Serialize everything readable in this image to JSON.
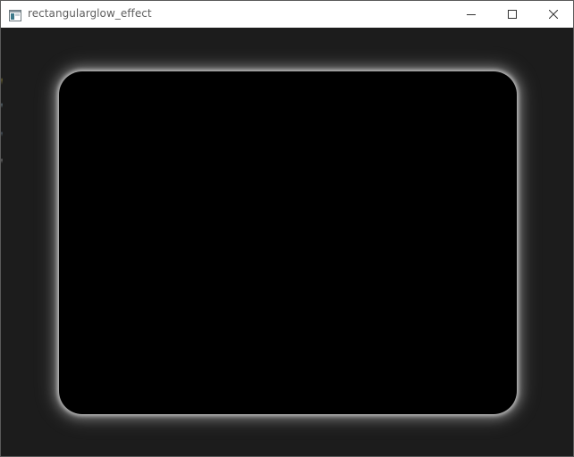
{
  "window": {
    "title": "rectangularglow_effect",
    "app_icon": "app-window-icon",
    "controls": {
      "minimize_icon": "minimize-icon",
      "maximize_icon": "maximize-icon",
      "close_icon": "close-icon"
    }
  },
  "scene": {
    "effect": "RectangularGlow",
    "rect_color": "#000000",
    "glow_color": "#ffffff",
    "background_color": "#1c1c1c"
  }
}
